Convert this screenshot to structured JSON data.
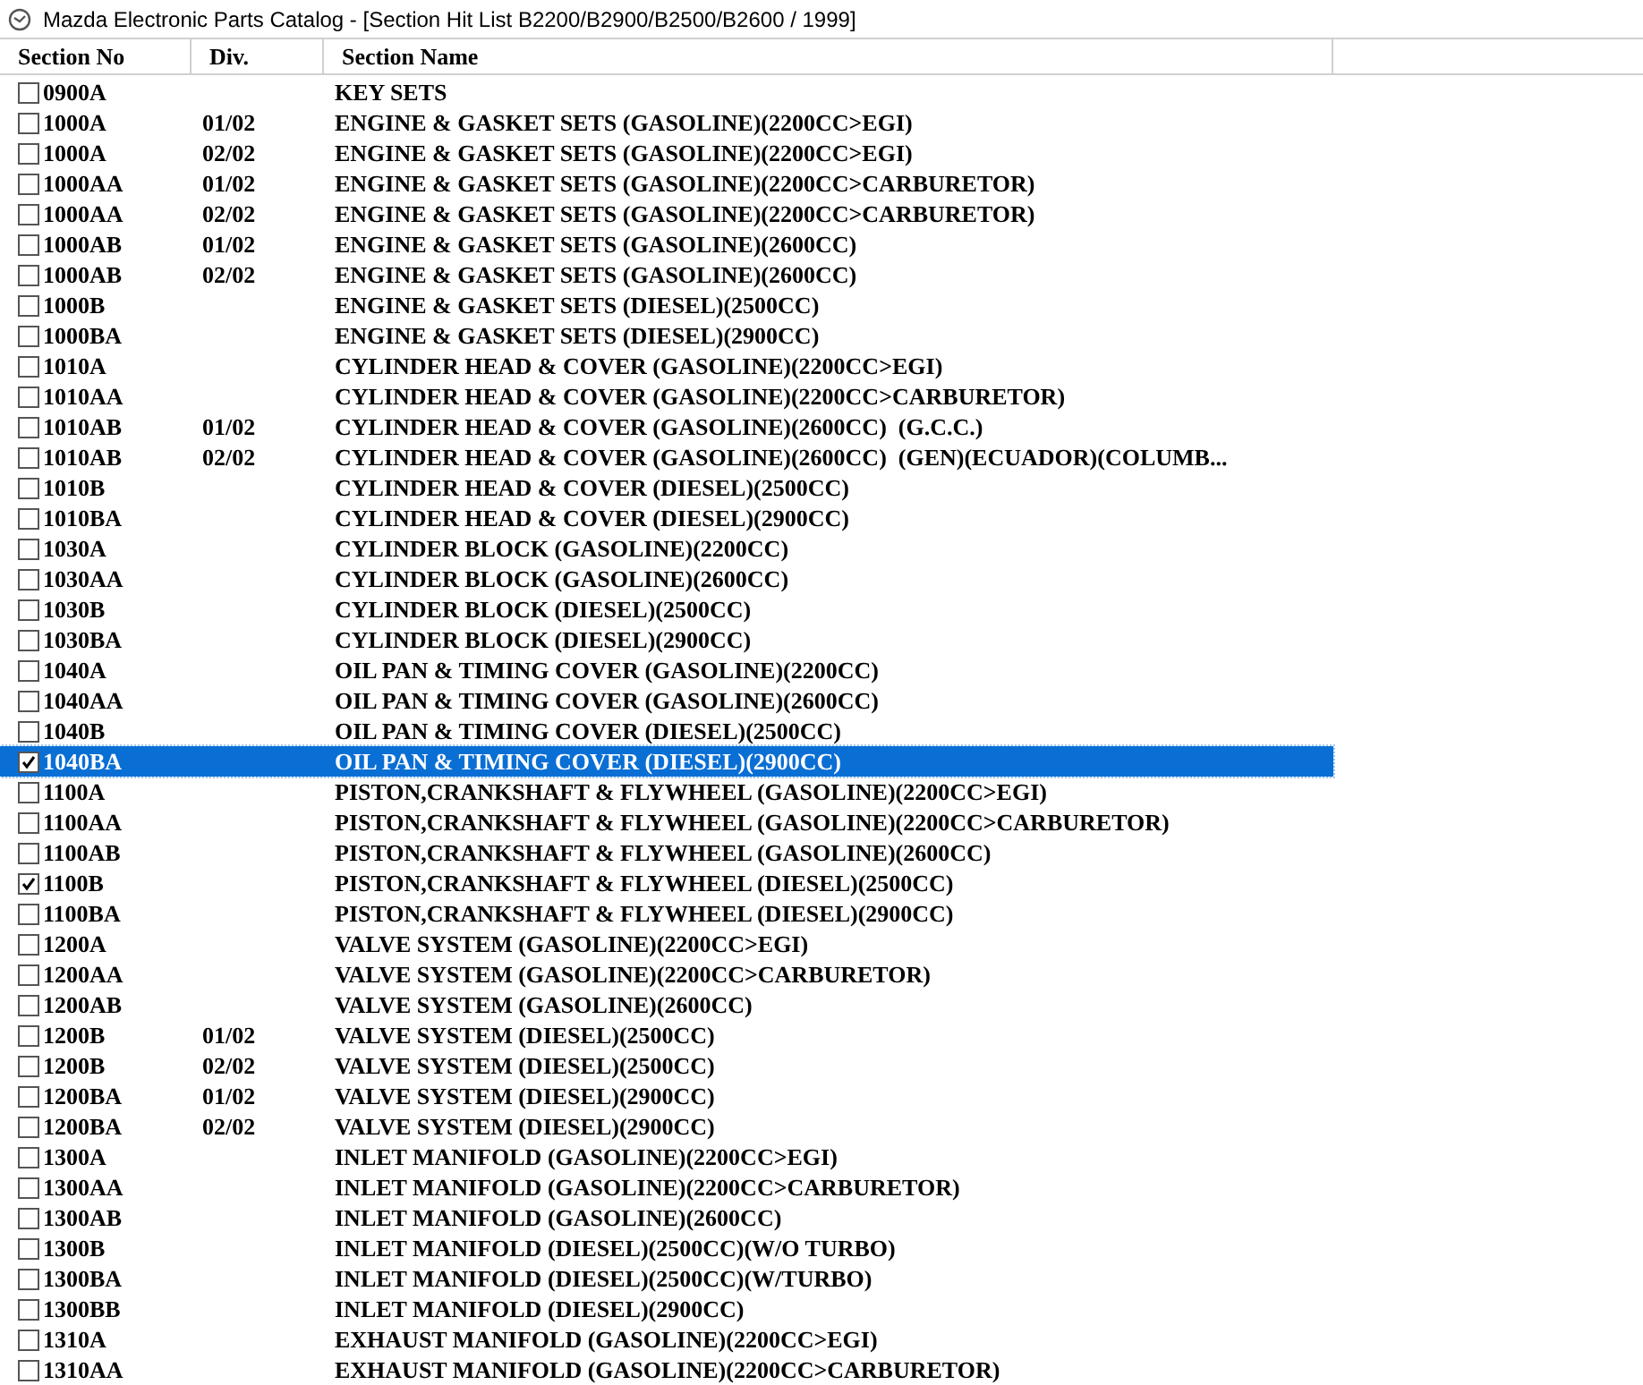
{
  "window": {
    "title": "Mazda Electronic Parts Catalog - [Section Hit List B2200/B2900/B2500/B2600 / 1999]"
  },
  "table": {
    "columns": [
      "Section No",
      "Div.",
      "Section Name"
    ],
    "rows": [
      {
        "section_no": "0900A",
        "div": "",
        "name": "KEY SETS",
        "checked": false,
        "selected": false
      },
      {
        "section_no": "1000A",
        "div": "01/02",
        "name": "ENGINE & GASKET SETS (GASOLINE)(2200CC>EGI)",
        "checked": false,
        "selected": false
      },
      {
        "section_no": "1000A",
        "div": "02/02",
        "name": "ENGINE & GASKET SETS (GASOLINE)(2200CC>EGI)",
        "checked": false,
        "selected": false
      },
      {
        "section_no": "1000AA",
        "div": "01/02",
        "name": "ENGINE & GASKET SETS (GASOLINE)(2200CC>CARBURETOR)",
        "checked": false,
        "selected": false
      },
      {
        "section_no": "1000AA",
        "div": "02/02",
        "name": "ENGINE & GASKET SETS (GASOLINE)(2200CC>CARBURETOR)",
        "checked": false,
        "selected": false
      },
      {
        "section_no": "1000AB",
        "div": "01/02",
        "name": "ENGINE & GASKET SETS (GASOLINE)(2600CC)",
        "checked": false,
        "selected": false
      },
      {
        "section_no": "1000AB",
        "div": "02/02",
        "name": "ENGINE & GASKET SETS (GASOLINE)(2600CC)",
        "checked": false,
        "selected": false
      },
      {
        "section_no": "1000B",
        "div": "",
        "name": "ENGINE & GASKET SETS (DIESEL)(2500CC)",
        "checked": false,
        "selected": false
      },
      {
        "section_no": "1000BA",
        "div": "",
        "name": "ENGINE & GASKET SETS (DIESEL)(2900CC)",
        "checked": false,
        "selected": false
      },
      {
        "section_no": "1010A",
        "div": "",
        "name": "CYLINDER HEAD & COVER (GASOLINE)(2200CC>EGI)",
        "checked": false,
        "selected": false
      },
      {
        "section_no": "1010AA",
        "div": "",
        "name": "CYLINDER HEAD & COVER (GASOLINE)(2200CC>CARBURETOR)",
        "checked": false,
        "selected": false
      },
      {
        "section_no": "1010AB",
        "div": "01/02",
        "name": "CYLINDER HEAD & COVER (GASOLINE)(2600CC)  (G.C.C.)",
        "checked": false,
        "selected": false
      },
      {
        "section_no": "1010AB",
        "div": "02/02",
        "name": "CYLINDER HEAD & COVER (GASOLINE)(2600CC)  (GEN)(ECUADOR)(COLUMB...",
        "checked": false,
        "selected": false
      },
      {
        "section_no": "1010B",
        "div": "",
        "name": "CYLINDER HEAD & COVER (DIESEL)(2500CC)",
        "checked": false,
        "selected": false
      },
      {
        "section_no": "1010BA",
        "div": "",
        "name": "CYLINDER HEAD & COVER (DIESEL)(2900CC)",
        "checked": false,
        "selected": false
      },
      {
        "section_no": "1030A",
        "div": "",
        "name": "CYLINDER BLOCK (GASOLINE)(2200CC)",
        "checked": false,
        "selected": false
      },
      {
        "section_no": "1030AA",
        "div": "",
        "name": "CYLINDER BLOCK (GASOLINE)(2600CC)",
        "checked": false,
        "selected": false
      },
      {
        "section_no": "1030B",
        "div": "",
        "name": "CYLINDER BLOCK (DIESEL)(2500CC)",
        "checked": false,
        "selected": false
      },
      {
        "section_no": "1030BA",
        "div": "",
        "name": "CYLINDER BLOCK (DIESEL)(2900CC)",
        "checked": false,
        "selected": false
      },
      {
        "section_no": "1040A",
        "div": "",
        "name": "OIL PAN & TIMING COVER (GASOLINE)(2200CC)",
        "checked": false,
        "selected": false
      },
      {
        "section_no": "1040AA",
        "div": "",
        "name": "OIL PAN & TIMING COVER (GASOLINE)(2600CC)",
        "checked": false,
        "selected": false
      },
      {
        "section_no": "1040B",
        "div": "",
        "name": "OIL PAN & TIMING COVER (DIESEL)(2500CC)",
        "checked": false,
        "selected": false
      },
      {
        "section_no": "1040BA",
        "div": "",
        "name": "OIL PAN & TIMING COVER (DIESEL)(2900CC)",
        "checked": true,
        "selected": true
      },
      {
        "section_no": "1100A",
        "div": "",
        "name": "PISTON,CRANKSHAFT & FLYWHEEL (GASOLINE)(2200CC>EGI)",
        "checked": false,
        "selected": false
      },
      {
        "section_no": "1100AA",
        "div": "",
        "name": "PISTON,CRANKSHAFT & FLYWHEEL (GASOLINE)(2200CC>CARBURETOR)",
        "checked": false,
        "selected": false
      },
      {
        "section_no": "1100AB",
        "div": "",
        "name": "PISTON,CRANKSHAFT & FLYWHEEL (GASOLINE)(2600CC)",
        "checked": false,
        "selected": false
      },
      {
        "section_no": "1100B",
        "div": "",
        "name": "PISTON,CRANKSHAFT & FLYWHEEL (DIESEL)(2500CC)",
        "checked": true,
        "selected": false
      },
      {
        "section_no": "1100BA",
        "div": "",
        "name": "PISTON,CRANKSHAFT & FLYWHEEL (DIESEL)(2900CC)",
        "checked": false,
        "selected": false
      },
      {
        "section_no": "1200A",
        "div": "",
        "name": "VALVE SYSTEM (GASOLINE)(2200CC>EGI)",
        "checked": false,
        "selected": false
      },
      {
        "section_no": "1200AA",
        "div": "",
        "name": "VALVE SYSTEM (GASOLINE)(2200CC>CARBURETOR)",
        "checked": false,
        "selected": false
      },
      {
        "section_no": "1200AB",
        "div": "",
        "name": "VALVE SYSTEM (GASOLINE)(2600CC)",
        "checked": false,
        "selected": false
      },
      {
        "section_no": "1200B",
        "div": "01/02",
        "name": "VALVE SYSTEM (DIESEL)(2500CC)",
        "checked": false,
        "selected": false
      },
      {
        "section_no": "1200B",
        "div": "02/02",
        "name": "VALVE SYSTEM (DIESEL)(2500CC)",
        "checked": false,
        "selected": false
      },
      {
        "section_no": "1200BA",
        "div": "01/02",
        "name": "VALVE SYSTEM (DIESEL)(2900CC)",
        "checked": false,
        "selected": false
      },
      {
        "section_no": "1200BA",
        "div": "02/02",
        "name": "VALVE SYSTEM (DIESEL)(2900CC)",
        "checked": false,
        "selected": false
      },
      {
        "section_no": "1300A",
        "div": "",
        "name": "INLET MANIFOLD (GASOLINE)(2200CC>EGI)",
        "checked": false,
        "selected": false
      },
      {
        "section_no": "1300AA",
        "div": "",
        "name": "INLET MANIFOLD (GASOLINE)(2200CC>CARBURETOR)",
        "checked": false,
        "selected": false
      },
      {
        "section_no": "1300AB",
        "div": "",
        "name": "INLET MANIFOLD (GASOLINE)(2600CC)",
        "checked": false,
        "selected": false
      },
      {
        "section_no": "1300B",
        "div": "",
        "name": "INLET MANIFOLD (DIESEL)(2500CC)(W/O TURBO)",
        "checked": false,
        "selected": false
      },
      {
        "section_no": "1300BA",
        "div": "",
        "name": "INLET MANIFOLD (DIESEL)(2500CC)(W/TURBO)",
        "checked": false,
        "selected": false
      },
      {
        "section_no": "1300BB",
        "div": "",
        "name": "INLET MANIFOLD (DIESEL)(2900CC)",
        "checked": false,
        "selected": false
      },
      {
        "section_no": "1310A",
        "div": "",
        "name": "EXHAUST MANIFOLD (GASOLINE)(2200CC>EGI)",
        "checked": false,
        "selected": false
      },
      {
        "section_no": "1310AA",
        "div": "",
        "name": "EXHAUST MANIFOLD (GASOLINE)(2200CC>CARBURETOR)",
        "checked": false,
        "selected": false
      }
    ]
  }
}
